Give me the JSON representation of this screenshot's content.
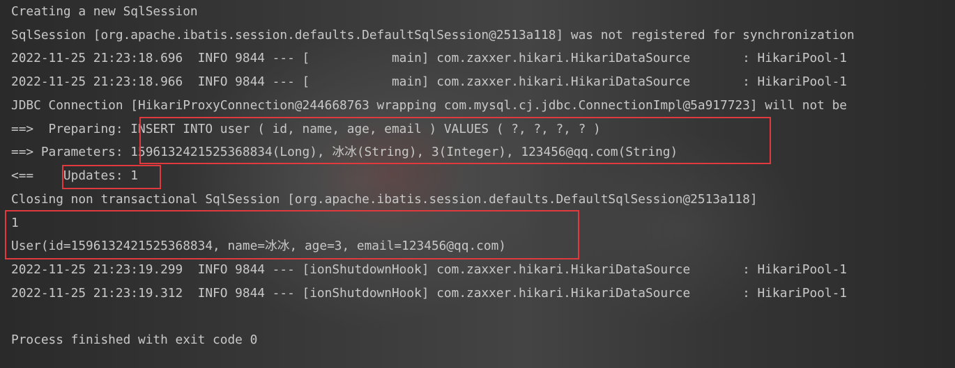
{
  "console": {
    "lines": [
      "Creating a new SqlSession",
      "SqlSession [org.apache.ibatis.session.defaults.DefaultSqlSession@2513a118] was not registered for synchronization",
      "2022-11-25 21:23:18.696  INFO 9844 --- [           main] com.zaxxer.hikari.HikariDataSource       : HikariPool-1",
      "2022-11-25 21:23:18.966  INFO 9844 --- [           main] com.zaxxer.hikari.HikariDataSource       : HikariPool-1",
      "JDBC Connection [HikariProxyConnection@244668763 wrapping com.mysql.cj.jdbc.ConnectionImpl@5a917723] will not be",
      "==>  Preparing: INSERT INTO user ( id, name, age, email ) VALUES ( ?, ?, ?, ? )",
      "==> Parameters: 1596132421525368834(Long), 冰冰(String), 3(Integer), 123456@qq.com(String)",
      "<==    Updates: 1",
      "Closing non transactional SqlSession [org.apache.ibatis.session.defaults.DefaultSqlSession@2513a118]",
      "1",
      "User(id=1596132421525368834, name=冰冰, age=3, email=123456@qq.com)",
      "2022-11-25 21:23:19.299  INFO 9844 --- [ionShutdownHook] com.zaxxer.hikari.HikariDataSource       : HikariPool-1",
      "2022-11-25 21:23:19.312  INFO 9844 --- [ionShutdownHook] com.zaxxer.hikari.HikariDataSource       : HikariPool-1",
      "",
      "Process finished with exit code 0"
    ]
  },
  "colors": {
    "text": "#c8c8c8",
    "highlight_border": "#e0393e",
    "background": "#2b2b2b"
  }
}
